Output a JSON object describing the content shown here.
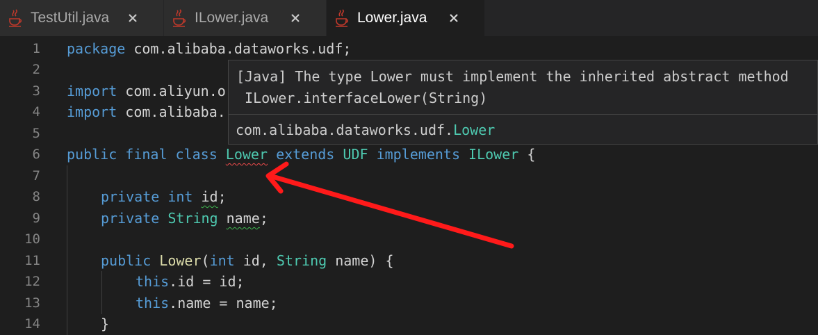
{
  "tabs": [
    {
      "label": "TestUtil.java",
      "active": false,
      "icon": "java-icon"
    },
    {
      "label": "ILower.java",
      "active": false,
      "icon": "java-icon"
    },
    {
      "label": "Lower.java",
      "active": true,
      "icon": "java-icon"
    }
  ],
  "editor": {
    "line_numbers": [
      "1",
      "2",
      "3",
      "4",
      "5",
      "6",
      "7",
      "8",
      "9",
      "10",
      "11",
      "12",
      "13",
      "14"
    ],
    "lines": {
      "l1": {
        "kw": "package",
        "rest": " com.alibaba.dataworks.udf;"
      },
      "l3": {
        "kw": "import",
        "rest": " com.aliyun.o"
      },
      "l4": {
        "kw": "import",
        "rest": " com.alibaba."
      },
      "l6": {
        "kw1": "public final class",
        "cls": "Lower",
        "kw2": "extends",
        "udf": "UDF",
        "kw3": "implements",
        "iface": "ILower",
        "brace": " {"
      },
      "l8": {
        "kw": "private int",
        "name": "id",
        "semi": ";"
      },
      "l9": {
        "kw": "private",
        "ty": "String",
        "name": "name",
        "semi": ";"
      },
      "l11": {
        "kw": "public",
        "fn": "Lower",
        "p1": "(",
        "kw2": "int",
        "p2": " id, ",
        "ty": "String",
        "p3": " name) {"
      },
      "l12": {
        "kw": "this",
        "rest": ".id = id;"
      },
      "l13": {
        "kw": "this",
        "rest": ".name = name;"
      },
      "l14": {
        "rest": "}"
      }
    }
  },
  "hover": {
    "message_line1": "[Java] The type Lower must implement the inherited abstract method",
    "message_line2": " ILower.interfaceLower(String)",
    "location_prefix": "com.alibaba.dataworks.udf.",
    "location_class": "Lower"
  },
  "colors": {
    "background": "#1e1e1e",
    "keyword": "#569cd6",
    "type": "#4ec9b0",
    "function": "#dcdcaa",
    "error_squiggle": "#f14c4c",
    "annotation_arrow": "#ff1a1a"
  }
}
